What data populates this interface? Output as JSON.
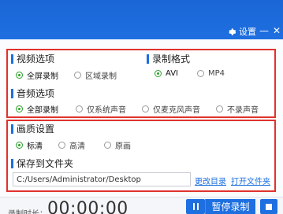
{
  "titlebar": {
    "settings_icon": "gear-icon",
    "settings_label": "设置",
    "minimize_label": "—",
    "close_label": "✕"
  },
  "video_options": {
    "title": "视频选项",
    "options": [
      {
        "label": "全屏录制",
        "checked": true
      },
      {
        "label": "区域录制",
        "checked": false
      }
    ]
  },
  "record_format": {
    "title": "录制格式",
    "options": [
      {
        "label": "AVI",
        "checked": true
      },
      {
        "label": "MP4",
        "checked": false
      }
    ]
  },
  "audio_options": {
    "title": "音频选项",
    "options": [
      {
        "label": "全部录制",
        "checked": true
      },
      {
        "label": "仅系统声音",
        "checked": false
      },
      {
        "label": "仅麦克风声音",
        "checked": false
      },
      {
        "label": "不录声音",
        "checked": false
      }
    ]
  },
  "quality": {
    "title": "画质设置",
    "options": [
      {
        "label": "标清",
        "checked": true
      },
      {
        "label": "高清",
        "checked": false
      },
      {
        "label": "原画",
        "checked": false
      }
    ]
  },
  "save_folder": {
    "title": "保存到文件夹",
    "path": "C:/Users/Administrator/Desktop",
    "change_link": "更改目录",
    "open_link": "打开文件夹"
  },
  "bottom": {
    "duration_label": "录制时长：",
    "duration_value": "00:00:00",
    "pause_label": "暂停录制",
    "pause_icon": "pause-icon",
    "stop_icon": "stop-icon"
  },
  "colors": {
    "accent": "#1e6fe0",
    "highlight_border": "#e0322e",
    "radio_checked": "#2aa12a"
  }
}
